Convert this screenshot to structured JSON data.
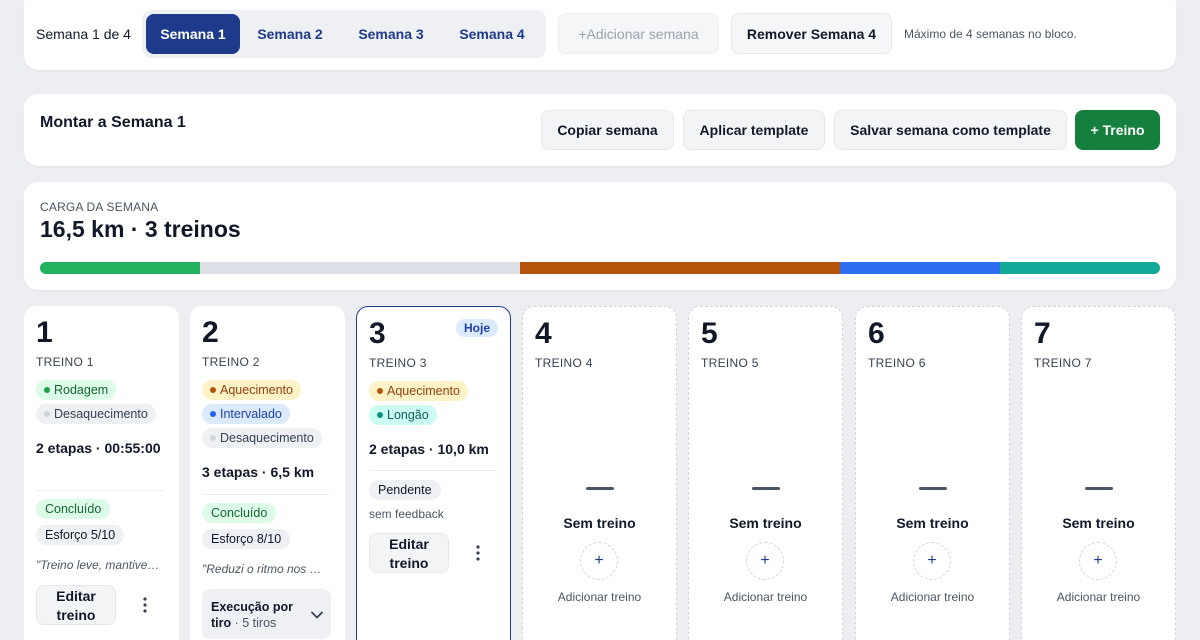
{
  "week_bar": {
    "label": "Semana 1 de 4",
    "tabs": [
      "Semana 1",
      "Semana 2",
      "Semana 3",
      "Semana 4"
    ],
    "active_tab": 0,
    "add_label": "+Adicionar semana",
    "remove_label": "Remover Semana 4",
    "note": "Máximo de 4 semanas no bloco."
  },
  "build": {
    "title": "Montar a Semana 1",
    "copy_label": "Copiar semana",
    "apply_label": "Aplicar template",
    "save_label": "Salvar semana como template",
    "add_label": "+ Treino"
  },
  "load": {
    "label": "CARGA DA SEMANA",
    "value": "16,5 km · 3 treinos",
    "segments": [
      {
        "fraction": 0.1429,
        "color": "#22b35e"
      },
      {
        "fraction": 0.2857,
        "color": "#dde1e7"
      },
      {
        "fraction": 0.2857,
        "color": "#b45309"
      },
      {
        "fraction": 0.1429,
        "color": "#2f6df0"
      },
      {
        "fraction": 0.1428,
        "color": "#14a898"
      }
    ]
  },
  "days": [
    {
      "num": "1",
      "name": "TREINO 1",
      "tags": [
        {
          "label": "Rodagem",
          "kind": "green"
        },
        {
          "label": "Desaquecimento",
          "kind": "gray"
        }
      ],
      "summary": "2 etapas · 00:55:00",
      "status": "Concluído",
      "effort": "Esforço 5/10",
      "note": "\"Treino leve, mantive o ritmo\"",
      "edit_label": "Editar treino"
    },
    {
      "num": "2",
      "name": "TREINO 2",
      "tags": [
        {
          "label": "Aquecimento",
          "kind": "amber"
        },
        {
          "label": "Intervalado",
          "kind": "blue"
        },
        {
          "label": "Desaquecimento",
          "kind": "gray"
        }
      ],
      "summary": "3 etapas · 6,5 km",
      "status": "Concluído",
      "effort": "Esforço 8/10",
      "note": "\"Reduzi o ritmo nos dois últimos tiros\"",
      "exec_label": "Execução por tiro",
      "exec_count": "· 5 tiros"
    },
    {
      "num": "3",
      "name": "TREINO 3",
      "badge": "Hoje",
      "tags": [
        {
          "label": "Aquecimento",
          "kind": "amber"
        },
        {
          "label": "Longão",
          "kind": "teal"
        }
      ],
      "summary": "2 etapas · 10,0 km",
      "status": "Pendente",
      "feedback": "sem feedback",
      "edit_label": "Editar treino"
    },
    {
      "num": "4",
      "name": "TREINO 4",
      "empty_title": "Sem treino",
      "add_label": "Adicionar treino"
    },
    {
      "num": "5",
      "name": "TREINO 5",
      "empty_title": "Sem treino",
      "add_label": "Adicionar treino"
    },
    {
      "num": "6",
      "name": "TREINO 6",
      "empty_title": "Sem treino",
      "add_label": "Adicionar treino"
    },
    {
      "num": "7",
      "name": "TREINO 7",
      "empty_title": "Sem treino",
      "add_label": "Adicionar treino"
    }
  ],
  "icons": {
    "kebab": "more-vertical-icon",
    "chevron": "chevron-down-icon",
    "plus": "plus-icon",
    "dash": "dash-icon"
  }
}
